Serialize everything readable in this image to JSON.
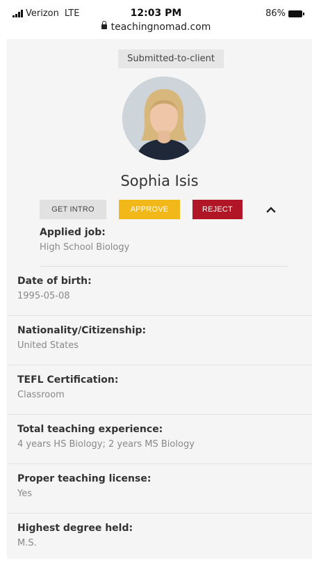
{
  "status_bar": {
    "carrier": "Verizon",
    "network": "LTE",
    "time": "12:03 PM",
    "url": "teachingnomad.com",
    "battery": "86%"
  },
  "profile": {
    "status": "Submitted-to-client",
    "name": "Sophia Isis"
  },
  "actions": {
    "intro_label": "GET INTRO",
    "approve_label": "APPROVE",
    "reject_label": "REJECT"
  },
  "applied": {
    "label": "Applied job:",
    "value": "High School Biology"
  },
  "fields": [
    {
      "label": "Date of birth:",
      "value": "1995-05-08"
    },
    {
      "label": "Nationality/Citizenship:",
      "value": "United States"
    },
    {
      "label": "TEFL Certification:",
      "value": "Classroom"
    },
    {
      "label": "Total teaching experience:",
      "value": "4 years HS Biology; 2 years MS Biology"
    },
    {
      "label": "Proper teaching license:",
      "value": "Yes"
    },
    {
      "label": "Highest degree held:",
      "value": "M.S."
    }
  ],
  "colors": {
    "approve": "#f2b718",
    "reject": "#b01625",
    "panel_bg": "#f5f5f5"
  }
}
